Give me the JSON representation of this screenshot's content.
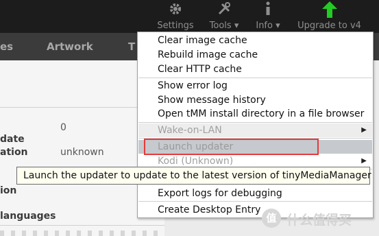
{
  "toolbar": {
    "settings_label": "Settings",
    "tools_label": "Tools ▾",
    "info_label": "Info ▾",
    "upgrade_label": "Upgrade to v4",
    "upgrade_color": "#22cc22"
  },
  "tabs": [
    "es",
    "Artwork",
    "T"
  ],
  "panel": {
    "value_zero": "0",
    "label_date": "date",
    "label_ation": "ation",
    "value_unknown": "unknown",
    "label_ion": "ion",
    "label_languages": "languages"
  },
  "menu": {
    "items": [
      "Clear image cache",
      "Rebuild image cache",
      "Clear HTTP cache",
      "Show error log",
      "Show message history",
      "Open tMM install directory in a file browser",
      "Wake-on-LAN",
      "Launch updater",
      "Kodi (Unknown)",
      "Export logs for debugging",
      "Create Desktop Entry"
    ],
    "highlight_color": "#e33b3b"
  },
  "tooltip": "Launch the updater to update to the latest version of tinyMediaManager",
  "watermark": {
    "circle_text": "值",
    "text": "什么值得买"
  }
}
